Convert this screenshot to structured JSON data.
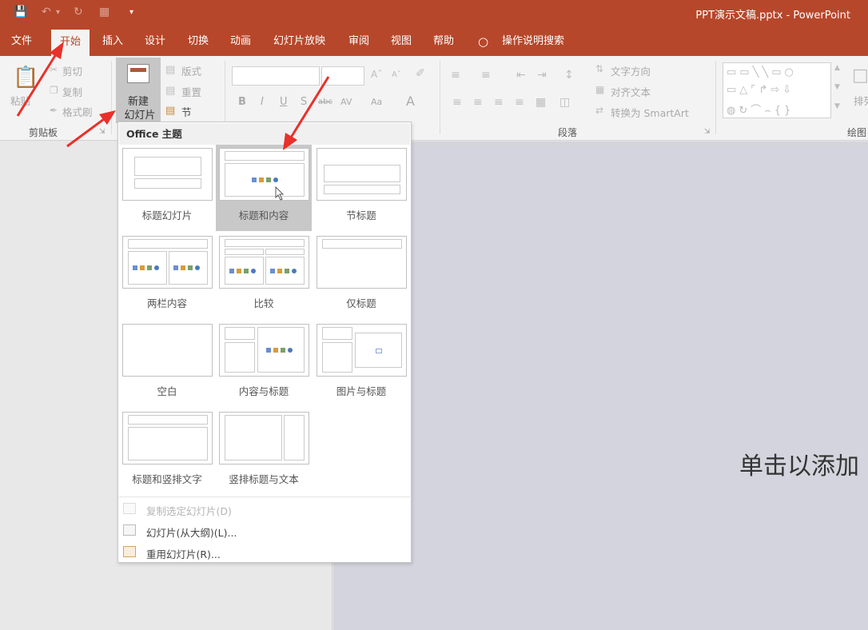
{
  "window": {
    "title": "PPT演示文稿.pptx - PowerPoint",
    "quick_access": [
      "save-icon",
      "undo-icon",
      "redo-icon",
      "present-icon",
      "customize-icon"
    ]
  },
  "tabs": [
    {
      "label": "文件"
    },
    {
      "label": "开始",
      "active": true
    },
    {
      "label": "插入"
    },
    {
      "label": "设计"
    },
    {
      "label": "切换"
    },
    {
      "label": "动画"
    },
    {
      "label": "幻灯片放映"
    },
    {
      "label": "审阅"
    },
    {
      "label": "视图"
    },
    {
      "label": "帮助"
    },
    {
      "label": "操作说明搜索"
    }
  ],
  "ribbon": {
    "clipboard": {
      "paste_label": "粘贴",
      "cut_label": "剪切",
      "copy_label": "复制",
      "format_painter_label": "格式刷",
      "group_label": "剪贴板"
    },
    "slides": {
      "new_slide_line1": "新建",
      "new_slide_line2": "幻灯片",
      "layout_label": "版式",
      "reset_label": "重置",
      "section_label": "节"
    },
    "font": {
      "bold": "B",
      "italic": "I",
      "underline": "U",
      "shadow": "S",
      "strike": "abc",
      "spacing": "AV",
      "change_case": "Aa",
      "font_color": "A"
    },
    "paragraph": {
      "text_direction_label": "文字方向",
      "align_text_label": "对齐文本",
      "convert_smartart_label": "转换为 SmartArt",
      "group_label": "段落"
    },
    "drawing": {
      "arrange_label": "排列",
      "group_label": "绘图"
    }
  },
  "dropdown": {
    "header": "Office 主题",
    "layouts": [
      {
        "label": "标题幻灯片"
      },
      {
        "label": "标题和内容",
        "selected": true
      },
      {
        "label": "节标题"
      },
      {
        "label": "两栏内容"
      },
      {
        "label": "比较"
      },
      {
        "label": "仅标题"
      },
      {
        "label": "空白"
      },
      {
        "label": "内容与标题"
      },
      {
        "label": "图片与标题"
      },
      {
        "label": "标题和竖排文字"
      },
      {
        "label": "竖排标题与文本"
      }
    ],
    "commands": [
      {
        "label": "复制选定幻灯片(D)",
        "enabled": false
      },
      {
        "label": "幻灯片(从大纲)(L)...",
        "enabled": true
      },
      {
        "label": "重用幻灯片(R)...",
        "enabled": true
      }
    ]
  },
  "slide": {
    "title_placeholder": "单击以添加"
  },
  "colors": {
    "accent": "#b7472a",
    "annotation_arrow": "#e8312a",
    "selected_layout": "#c8c8c8"
  }
}
